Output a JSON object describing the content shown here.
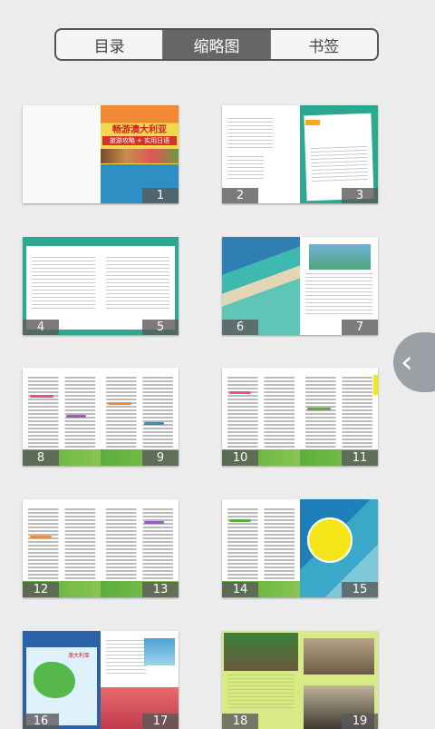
{
  "tabs": [
    {
      "label": "目录",
      "active": false
    },
    {
      "label": "缩略图",
      "active": true
    },
    {
      "label": "书签",
      "active": false
    }
  ],
  "cover": {
    "title": "畅游澳大利亚",
    "subtitle": "旅游攻略 + 实用日语"
  },
  "map_label": "澳大利亚",
  "page_numbers": [
    "1",
    "2",
    "3",
    "4",
    "5",
    "6",
    "7",
    "8",
    "9",
    "10",
    "11",
    "12",
    "13",
    "14",
    "15",
    "16",
    "17",
    "18",
    "19"
  ],
  "side_tab_icon": "chevron-left-icon",
  "colors": {
    "accent": "#666666",
    "teal": "#1a9f8a",
    "green": "#5aae3b",
    "yellow": "#f4e61a"
  }
}
